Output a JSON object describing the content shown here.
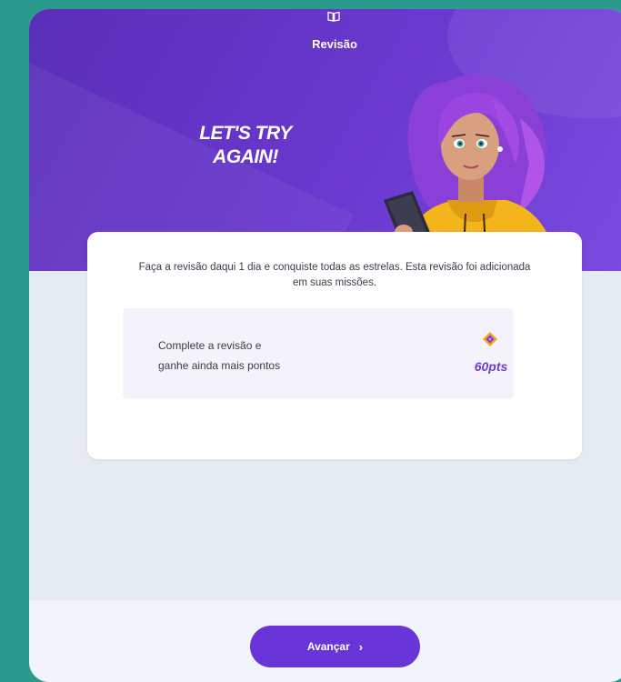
{
  "header": {
    "icon": "book-open-icon",
    "title": "Revisão"
  },
  "hero": {
    "headline_line1": "LET'S TRY",
    "headline_line2": "AGAIN!",
    "illustration": "character-with-tablet"
  },
  "card": {
    "message": "Faça a revisão daqui 1 dia e conquiste todas as estrelas. Esta revisão foi adicionada em suas missões.",
    "reward": {
      "line1": "Complete a revisão e",
      "line2": "ganhe ainda mais pontos",
      "icon": "gem-icon",
      "points": "60pts"
    }
  },
  "footer": {
    "button_label": "Avançar",
    "button_icon": "chevron-right-icon"
  },
  "colors": {
    "background": "#2a9a8f",
    "hero": "#6a38cf",
    "accent": "#6a35d8",
    "points": "#6a3fd0"
  }
}
